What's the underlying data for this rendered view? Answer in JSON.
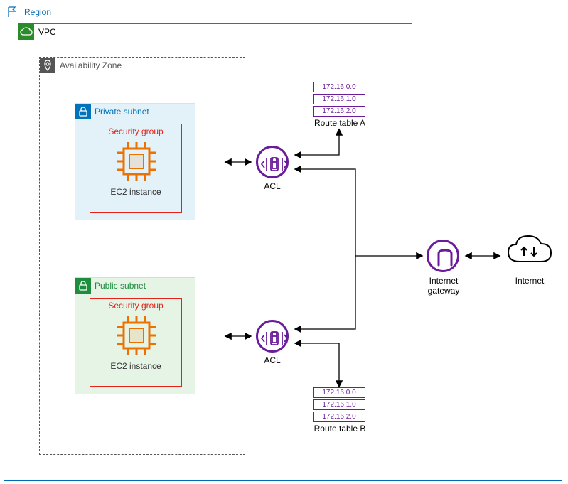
{
  "region": {
    "label": "Region"
  },
  "vpc": {
    "label": "VPC"
  },
  "az": {
    "label": "Availability Zone"
  },
  "private_subnet": {
    "label": "Private subnet"
  },
  "public_subnet": {
    "label": "Public subnet"
  },
  "security_group": {
    "label": "Security group"
  },
  "ec2": {
    "label": "EC2 instance"
  },
  "acl": {
    "label": "ACL"
  },
  "route_table_a": {
    "label": "Route table A",
    "rows": [
      "172.16.0.0",
      "172.16.1.0",
      "172.16.2.0"
    ]
  },
  "route_table_b": {
    "label": "Route table B",
    "rows": [
      "172.16.0.0",
      "172.16.1.0",
      "172.16.2.0"
    ]
  },
  "igw": {
    "label": "Internet gateway"
  },
  "internet": {
    "label": "Internet"
  }
}
